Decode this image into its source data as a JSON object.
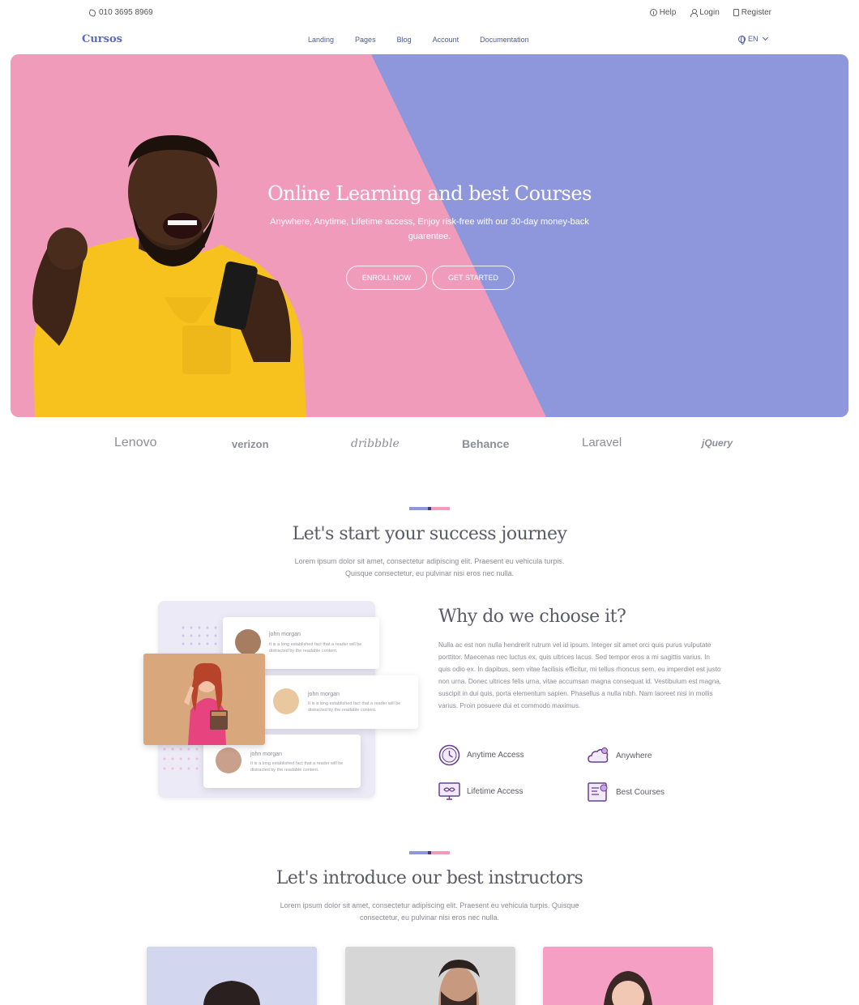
{
  "topbar": {
    "phone": "010 3695 8969",
    "help": "Help",
    "login": "Login",
    "register": "Register"
  },
  "nav": {
    "logo": "Cursos",
    "items": [
      "Landing",
      "Pages",
      "Blog",
      "Account",
      "Documentation"
    ],
    "language": "EN"
  },
  "hero": {
    "title": "Online Learning and best Courses",
    "subtitle": "Anywhere, Anytime, Lifetime access, Enjoy risk-free with our 30-day money-back guarentee.",
    "enroll_button": "ENROLL NOW",
    "started_button": "GET STARTED",
    "colors": {
      "pink": "#f19bba",
      "purple": "#8e97dc"
    }
  },
  "brands": [
    "Lenovo",
    "verizon",
    "dribbble",
    "Behance",
    "Laravel",
    "jQuery"
  ],
  "journey": {
    "title": "Let's start your success journey",
    "subtitle_line1": "Lorem ipsum dolor sit amet, consectetur adipiscing elit. Praesent eu vehicula turpis.",
    "subtitle_line2": "Quisque consectetur, eu pulvinar nisi eros nec nulla."
  },
  "testimonials": [
    {
      "name": "john morgan",
      "text": "It is a long established fact that a reader will be distracted by the readable content."
    },
    {
      "name": "john morgan",
      "text": "It is a long established fact that a reader will be distracted by the readable content."
    },
    {
      "name": "john morgan",
      "text": "It is a long established fact that a reader will be distracted by the readable content."
    }
  ],
  "why": {
    "title": "Why do we choose it?",
    "text": "Nulla ac est non nulla hendrerit rutrum vel id ipsum. Integer sit amet orci quis purus vulputate porttitor. Maecenas nec luctus ex, quis ultrices lacus. Sed tempor eros a mi sagittis varius. In quis odio ex. In dapibus, sem vitae facilisis efficitur, mi tellus rhoncus sem, eu imperdiet est justo non urna. Donec ultrices felis urna, vitae accumsan magna consequat id. Vestibulum est magna, suscipit in dui quis, porta elementum sapien. Phasellus a nulla nibh. Nam laoreet nisi in mollis varius. Proin posuere dui et commodo maximus.",
    "features": [
      "Anytime Access",
      "Anywhere",
      "Lifetime Access",
      "Best Courses"
    ]
  },
  "instructors": {
    "title": "Let's introduce our best instructors",
    "subtitle_line1": "Lorem ipsum dolor sit amet, consectetur adipiscing elit. Praesent eu vehicula turpis. Quisque",
    "subtitle_line2": "consectetur, eu pulvinar nisi eros nec nulla."
  }
}
